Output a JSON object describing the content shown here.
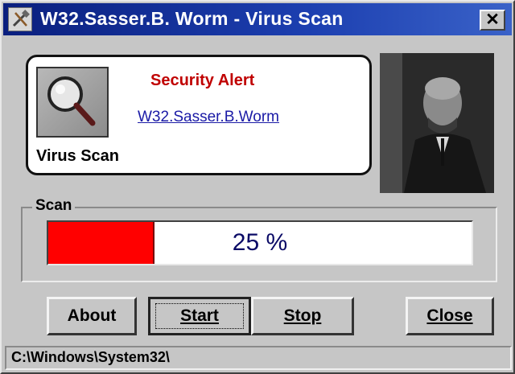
{
  "window": {
    "title": "W32.Sasser.B. Worm - Virus Scan",
    "close_glyph": "✕",
    "app_icon": "tools-icon"
  },
  "alert_panel": {
    "icon": "magnifier-icon",
    "label": "Virus Scan",
    "title": "Security Alert",
    "threat_link": "W32.Sasser.B.Worm"
  },
  "photo": {
    "icon": "portrait-photo"
  },
  "scan": {
    "legend": "Scan",
    "progress_text": "25 %",
    "progress_fraction": 0.25,
    "fill_color": "#ff0000"
  },
  "buttons": {
    "about": "About",
    "start": "Start",
    "stop": "Stop",
    "close": "Close"
  },
  "status": {
    "path": "C:\\Windows\\System32\\"
  },
  "colors": {
    "title_bar": "#0a1f7e",
    "alert_red": "#c00000",
    "link_blue": "#1a1aa6",
    "progress_text": "#0a0a66"
  }
}
